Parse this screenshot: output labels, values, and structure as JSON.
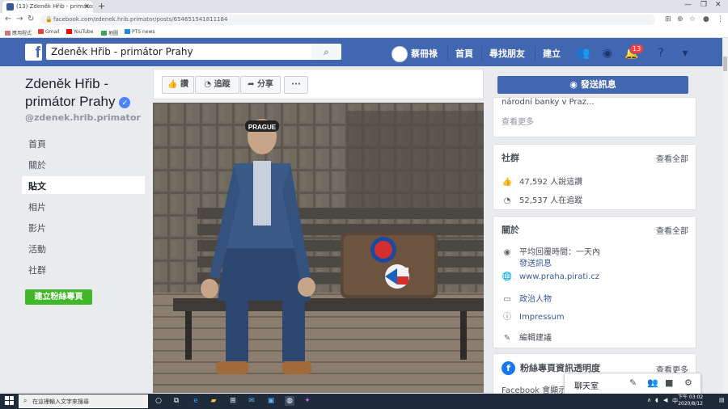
{
  "browser": {
    "tab_title": "(13) Zdeněk Hřib - primátor Pr...",
    "url": "facebook.com/zdenek.hrib.primator/posts/654651541811184",
    "bookmarks": [
      "應用程式",
      "Gmail",
      "YouTube",
      "地圖",
      "PTS news"
    ]
  },
  "header": {
    "search_value": "Zdeněk Hřib - primátor Prahy",
    "user_name": "蔡冊祿",
    "nav": [
      "首頁",
      "尋找朋友",
      "建立"
    ],
    "notification_count": "13"
  },
  "page": {
    "name": "Zdeněk Hřib - primátor Prahy",
    "handle": "@zdenek.hrib.primator",
    "left_nav": [
      "首頁",
      "關於",
      "貼文",
      "相片",
      "影片",
      "活動",
      "社群"
    ],
    "create_button": "建立粉絲專頁"
  },
  "actions": {
    "like": "讚",
    "follow": "追蹤",
    "share": "分享",
    "more": "···"
  },
  "photo": {
    "cap_text": "PRAGUE"
  },
  "right": {
    "message_button": "發送訊息",
    "top_card": {
      "snippet": "národní banky v Praz...",
      "see_more": "查看更多"
    },
    "community": {
      "title": "社群",
      "see_all": "查看全部",
      "likes": "47,592 人說這讚",
      "follows": "52,537 人在追蹤"
    },
    "about": {
      "title": "關於",
      "see_all": "查看全部",
      "response_time": "平均回覆時間：一天內",
      "send_message": "發送訊息",
      "website": "www.praha.pirati.cz",
      "category": "政治人物",
      "impressum": "Impressum",
      "suggest_edits": "編輯建議"
    },
    "transparency": {
      "title": "粉絲專頁資訊透明度",
      "see_more": "查看更多",
      "text": "Facebook 會顯示資"
    }
  },
  "chat": {
    "label": "聊天室"
  },
  "taskbar": {
    "search_placeholder": "在這裡輸入文字來搜尋",
    "time": "下午 03:02",
    "date": "2020/8/12",
    "ime": "中"
  },
  "colors": {
    "fb_blue": "#4267b2",
    "green": "#42b72a",
    "link": "#385898",
    "notif_red": "#fa3e3e"
  }
}
